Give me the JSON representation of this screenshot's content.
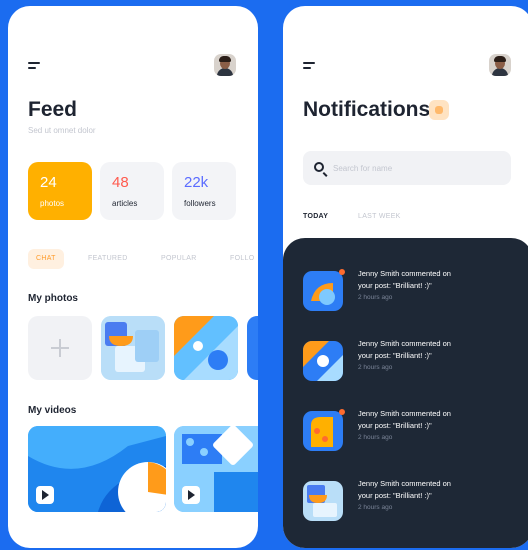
{
  "feed": {
    "title": "Feed",
    "subtitle": "Sed ut omnet dolor",
    "stats": [
      {
        "value": "24",
        "label": "photos"
      },
      {
        "value": "48",
        "label": "articles"
      },
      {
        "value": "22k",
        "label": "followers"
      }
    ],
    "tabs": [
      "CHAT",
      "FEATURED",
      "POPULAR",
      "FOLLO"
    ],
    "photos_title": "My photos",
    "videos_title": "My videos"
  },
  "notifications": {
    "title": "Notifications",
    "search_placeholder": "Search for name",
    "tabs": [
      "TODAY",
      "LAST WEEK"
    ],
    "items": [
      {
        "line1": "Jenny Smith commented on",
        "line2": "your post: \"Brilliant! :)\"",
        "time": "2 hours ago"
      },
      {
        "line1": "Jenny Smith commented on",
        "line2": "your post: \"Brilliant! :)\"",
        "time": "2 hours ago"
      },
      {
        "line1": "Jenny Smith commented on",
        "line2": "your post: \"Brilliant! :)\"",
        "time": "2 hours ago"
      },
      {
        "line1": "Jenny Smith commented on",
        "line2": "your post: \"Brilliant! :)\"",
        "time": "2 hours ago"
      }
    ]
  },
  "icons": [
    "menu-icon",
    "avatar",
    "add-icon",
    "play-icon",
    "search-icon",
    "bell-icon"
  ],
  "colors": {
    "background": "#1b6cf0",
    "accent_orange": "#ffb000",
    "articles_red": "#ff5a4e",
    "followers_blue": "#5b6cff",
    "dark_panel": "#1e2836"
  }
}
